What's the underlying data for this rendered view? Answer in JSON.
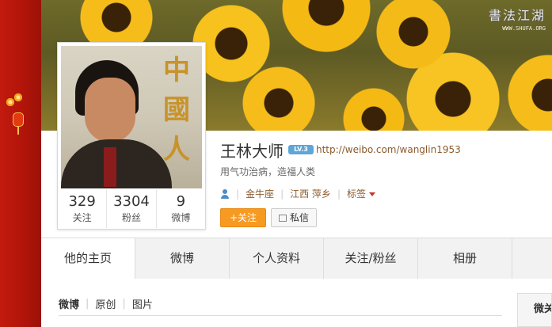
{
  "watermark": {
    "title": "書法江湖",
    "url": "WWW.SHUFA.ORG"
  },
  "avatar": {
    "calligraphy": "中國人"
  },
  "stats": [
    {
      "num": "329",
      "label": "关注"
    },
    {
      "num": "3304",
      "label": "粉丝"
    },
    {
      "num": "9",
      "label": "微博"
    }
  ],
  "profile": {
    "name": "王林大师",
    "level": "LV.3",
    "url": "http://weibo.com/wanglin1953",
    "bio": "用气功治病，造福人类",
    "zodiac": "金牛座",
    "location": "江西 萍乡",
    "tags_label": "标签"
  },
  "buttons": {
    "follow": "+关注",
    "message": "私信"
  },
  "tabs": [
    "他的主页",
    "微博",
    "个人资料",
    "关注/粉丝",
    "相册"
  ],
  "subnav": {
    "items": [
      "微博",
      "原创",
      "图片"
    ]
  },
  "side_box": {
    "label": "微关"
  },
  "colors": {
    "accent_orange": "#f79a22",
    "link_brown": "#8b5a2b",
    "banner_red": "#c21a0e"
  }
}
